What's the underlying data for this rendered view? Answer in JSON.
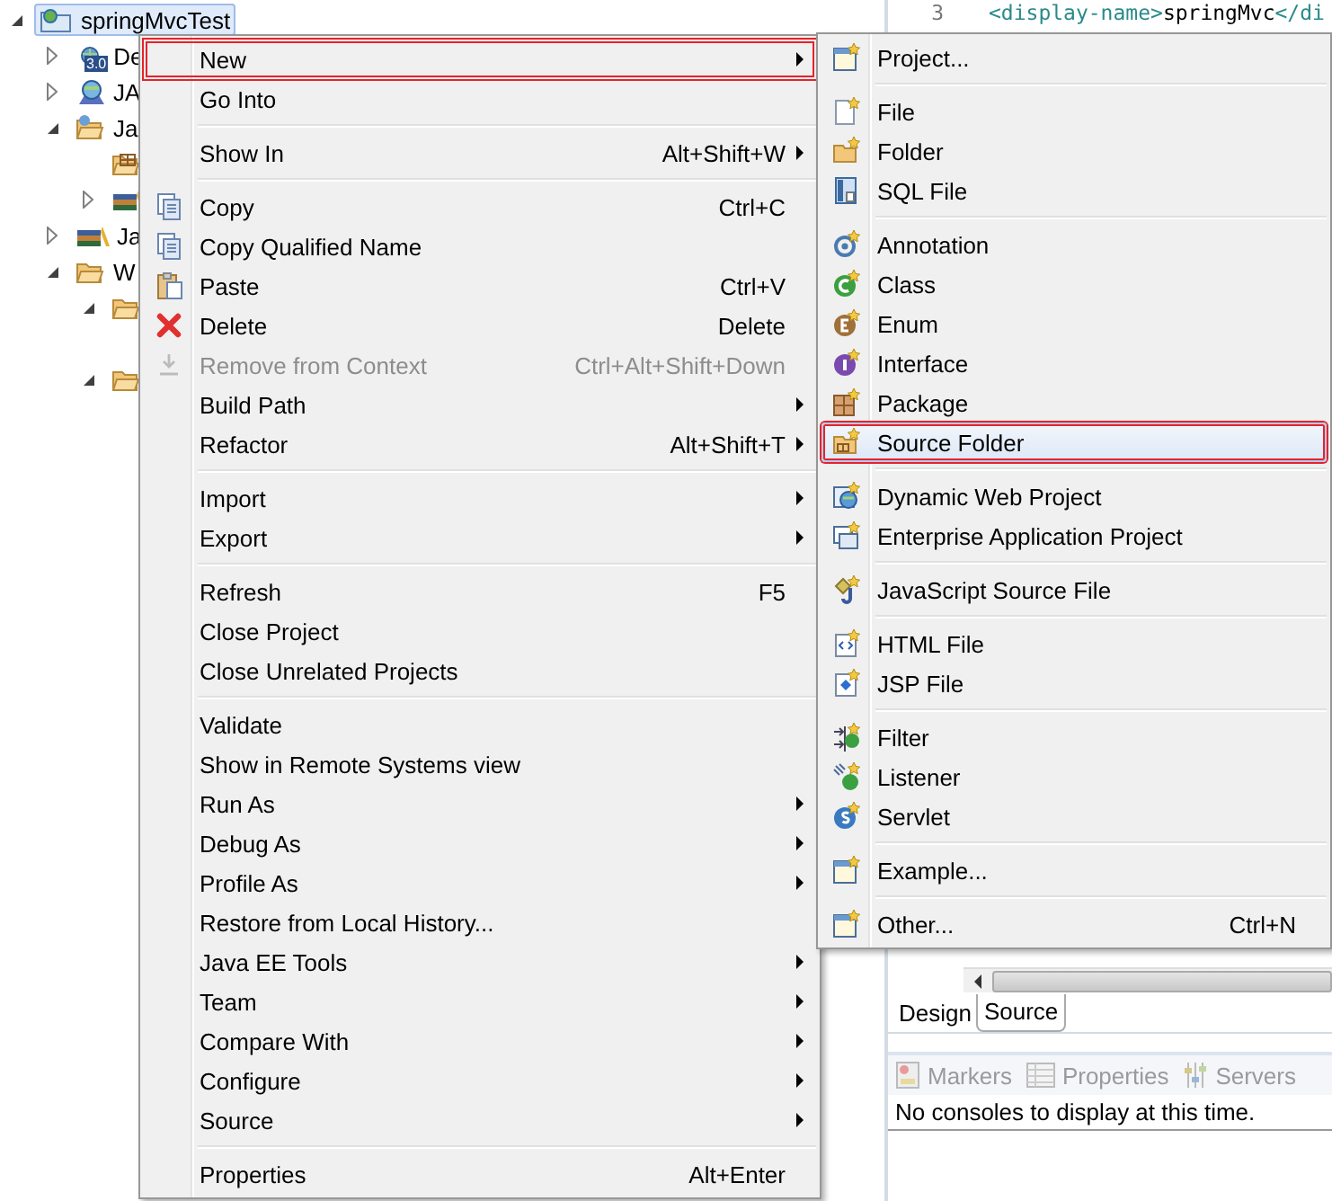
{
  "project_tree": {
    "items": [
      {
        "label": "springMvcTest",
        "kind": "project",
        "selected": true,
        "expanded": true,
        "children": [
          {
            "label": "De",
            "kind": "descriptor",
            "badge": "3.0",
            "selected": false,
            "expanded": false
          },
          {
            "label": "JA",
            "kind": "jaxws",
            "selected": false,
            "expanded": false
          },
          {
            "label": "Ja",
            "kind": "resources",
            "selected": false,
            "expanded": true,
            "children": [
              {
                "kind": "package-folder"
              },
              {
                "kind": "library",
                "expanded": false
              }
            ]
          },
          {
            "label": "Ja",
            "kind": "library",
            "selected": false,
            "expanded": false
          },
          {
            "label": "W",
            "kind": "folder",
            "selected": false,
            "expanded": true,
            "children": [
              {
                "kind": "folder",
                "expanded": true
              },
              {
                "kind": "folder",
                "expanded": true
              }
            ]
          }
        ]
      }
    ]
  },
  "editor": {
    "lines": [
      {
        "number": "3",
        "code": [
          {
            "kind": "tag",
            "text": "<display-name>"
          },
          {
            "kind": "text",
            "text": "springMvc"
          },
          {
            "kind": "tag",
            "text": "</di"
          }
        ]
      }
    ],
    "tabs": [
      {
        "label": "Design",
        "selected": false
      },
      {
        "label": "Source",
        "selected": true
      }
    ]
  },
  "console": {
    "tabs": [
      {
        "label": "Markers",
        "selected": false
      },
      {
        "label": "Properties",
        "selected": false
      },
      {
        "label": "Servers",
        "selected": false
      }
    ],
    "message": "No consoles to display at this time."
  },
  "context_menu": {
    "items": [
      {
        "kind": "item",
        "label": "New",
        "submenu": true,
        "disabled": false,
        "selected": false,
        "outlined": true
      },
      {
        "kind": "item",
        "label": "Go Into",
        "submenu": false,
        "disabled": false,
        "selected": false,
        "outlined": false
      },
      {
        "kind": "separator"
      },
      {
        "kind": "item",
        "label": "Show In",
        "shortcut": "Alt+Shift+W",
        "submenu": true,
        "disabled": false,
        "selected": false,
        "outlined": false
      },
      {
        "kind": "separator"
      },
      {
        "kind": "item",
        "label": "Copy",
        "shortcut": "Ctrl+C",
        "submenu": false,
        "disabled": false,
        "selected": false,
        "outlined": false
      },
      {
        "kind": "item",
        "label": "Copy Qualified Name",
        "submenu": false,
        "disabled": false,
        "selected": false,
        "outlined": false
      },
      {
        "kind": "item",
        "label": "Paste",
        "shortcut": "Ctrl+V",
        "submenu": false,
        "disabled": false,
        "selected": false,
        "outlined": false
      },
      {
        "kind": "item",
        "label": "Delete",
        "shortcut": "Delete",
        "submenu": false,
        "disabled": false,
        "selected": false,
        "outlined": false
      },
      {
        "kind": "item",
        "label": "Remove from Context",
        "shortcut": "Ctrl+Alt+Shift+Down",
        "submenu": false,
        "disabled": true,
        "selected": false,
        "outlined": false
      },
      {
        "kind": "item",
        "label": "Build Path",
        "submenu": true,
        "disabled": false,
        "selected": false,
        "outlined": false
      },
      {
        "kind": "item",
        "label": "Refactor",
        "shortcut": "Alt+Shift+T",
        "submenu": true,
        "disabled": false,
        "selected": false,
        "outlined": false
      },
      {
        "kind": "separator"
      },
      {
        "kind": "item",
        "label": "Import",
        "submenu": true,
        "disabled": false,
        "selected": false,
        "outlined": false
      },
      {
        "kind": "item",
        "label": "Export",
        "submenu": true,
        "disabled": false,
        "selected": false,
        "outlined": false
      },
      {
        "kind": "separator"
      },
      {
        "kind": "item",
        "label": "Refresh",
        "shortcut": "F5",
        "submenu": false,
        "disabled": false,
        "selected": false,
        "outlined": false
      },
      {
        "kind": "item",
        "label": "Close Project",
        "submenu": false,
        "disabled": false,
        "selected": false,
        "outlined": false
      },
      {
        "kind": "item",
        "label": "Close Unrelated Projects",
        "submenu": false,
        "disabled": false,
        "selected": false,
        "outlined": false
      },
      {
        "kind": "separator"
      },
      {
        "kind": "item",
        "label": "Validate",
        "submenu": false,
        "disabled": false,
        "selected": false,
        "outlined": false
      },
      {
        "kind": "item",
        "label": "Show in Remote Systems view",
        "submenu": false,
        "disabled": false,
        "selected": false,
        "outlined": false
      },
      {
        "kind": "item",
        "label": "Run As",
        "submenu": true,
        "disabled": false,
        "selected": false,
        "outlined": false
      },
      {
        "kind": "item",
        "label": "Debug As",
        "submenu": true,
        "disabled": false,
        "selected": false,
        "outlined": false
      },
      {
        "kind": "item",
        "label": "Profile As",
        "submenu": true,
        "disabled": false,
        "selected": false,
        "outlined": false
      },
      {
        "kind": "item",
        "label": "Restore from Local History...",
        "submenu": false,
        "disabled": false,
        "selected": false,
        "outlined": false
      },
      {
        "kind": "item",
        "label": "Java EE Tools",
        "submenu": true,
        "disabled": false,
        "selected": false,
        "outlined": false
      },
      {
        "kind": "item",
        "label": "Team",
        "submenu": true,
        "disabled": false,
        "selected": false,
        "outlined": false
      },
      {
        "kind": "item",
        "label": "Compare With",
        "submenu": true,
        "disabled": false,
        "selected": false,
        "outlined": false
      },
      {
        "kind": "item",
        "label": "Configure",
        "submenu": true,
        "disabled": false,
        "selected": false,
        "outlined": false
      },
      {
        "kind": "item",
        "label": "Source",
        "submenu": true,
        "disabled": false,
        "selected": false,
        "outlined": false
      },
      {
        "kind": "separator"
      },
      {
        "kind": "item",
        "label": "Properties",
        "shortcut": "Alt+Enter",
        "submenu": false,
        "disabled": false,
        "selected": false,
        "outlined": false
      }
    ]
  },
  "new_submenu": {
    "items": [
      {
        "kind": "item",
        "label": "Project...",
        "selected": false,
        "outlined": false
      },
      {
        "kind": "separator"
      },
      {
        "kind": "item",
        "label": "File",
        "selected": false,
        "outlined": false
      },
      {
        "kind": "item",
        "label": "Folder",
        "selected": false,
        "outlined": false
      },
      {
        "kind": "item",
        "label": "SQL File",
        "selected": false,
        "outlined": false
      },
      {
        "kind": "separator"
      },
      {
        "kind": "item",
        "label": "Annotation",
        "selected": false,
        "outlined": false
      },
      {
        "kind": "item",
        "label": "Class",
        "selected": false,
        "outlined": false
      },
      {
        "kind": "item",
        "label": "Enum",
        "selected": false,
        "outlined": false
      },
      {
        "kind": "item",
        "label": "Interface",
        "selected": false,
        "outlined": false
      },
      {
        "kind": "item",
        "label": "Package",
        "selected": false,
        "outlined": false
      },
      {
        "kind": "item",
        "label": "Source Folder",
        "selected": true,
        "outlined": true
      },
      {
        "kind": "separator"
      },
      {
        "kind": "item",
        "label": "Dynamic Web Project",
        "selected": false,
        "outlined": false
      },
      {
        "kind": "item",
        "label": "Enterprise Application Project",
        "selected": false,
        "outlined": false
      },
      {
        "kind": "separator"
      },
      {
        "kind": "item",
        "label": "JavaScript Source File",
        "selected": false,
        "outlined": false
      },
      {
        "kind": "separator"
      },
      {
        "kind": "item",
        "label": "HTML File",
        "selected": false,
        "outlined": false
      },
      {
        "kind": "item",
        "label": "JSP File",
        "selected": false,
        "outlined": false
      },
      {
        "kind": "separator"
      },
      {
        "kind": "item",
        "label": "Filter",
        "selected": false,
        "outlined": false
      },
      {
        "kind": "item",
        "label": "Listener",
        "selected": false,
        "outlined": false
      },
      {
        "kind": "item",
        "label": "Servlet",
        "selected": false,
        "outlined": false
      },
      {
        "kind": "separator"
      },
      {
        "kind": "item",
        "label": "Example...",
        "selected": false,
        "outlined": false
      },
      {
        "kind": "separator"
      },
      {
        "kind": "item",
        "label": "Other...",
        "shortcut": "Ctrl+N",
        "selected": false,
        "outlined": false
      }
    ]
  }
}
